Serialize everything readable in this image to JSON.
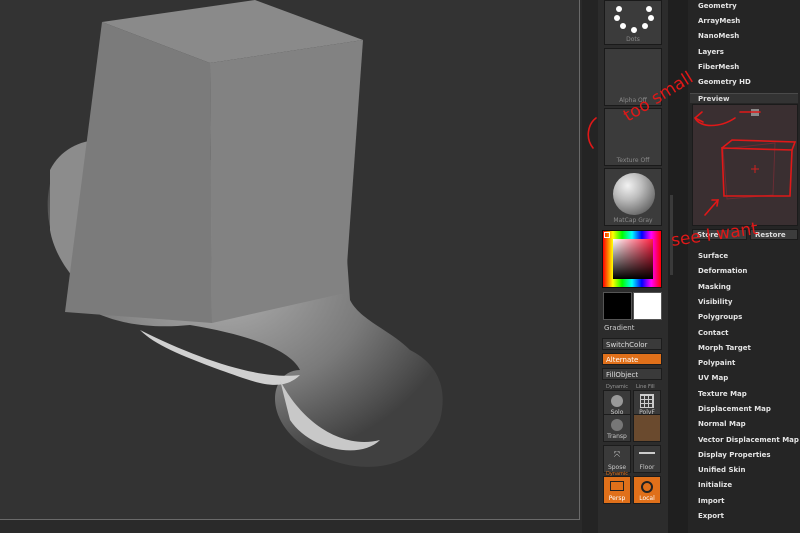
{
  "shelf": {
    "dots_label": "Dots",
    "alpha_label": "Alpha Off",
    "texture_label": "Texture Off",
    "matcap_label": "MatCap Gray",
    "gradient_label": "Gradient",
    "switchcolor_label": "SwitchColor",
    "alternate_label": "Alternate",
    "fillobject_label": "FillObject",
    "dynamic_label": "Dynamic",
    "linefill_label": "Line Fill",
    "solo_label": "Solo",
    "polyf_label": "PolyF",
    "transp_label": "Transp",
    "spose_label": "Spose",
    "floor_label": "Floor",
    "dynamic2_label": "Dynamic",
    "persp_label": "Persp",
    "local_label": "Local"
  },
  "menu": {
    "top_items": [
      "Geometry",
      "ArrayMesh",
      "NanoMesh",
      "Layers",
      "FiberMesh",
      "Geometry HD"
    ],
    "preview_label": "Preview",
    "store_label": "Store",
    "restore_label": "Restore",
    "bottom_items": [
      "Surface",
      "Deformation",
      "Masking",
      "Visibility",
      "Polygroups",
      "Contact",
      "Morph Target",
      "Polypaint",
      "UV Map",
      "Texture Map",
      "Displacement Map",
      "Normal Map",
      "Vector Displacement Map",
      "Display Properties",
      "Unified Skin",
      "Initialize",
      "Import",
      "Export"
    ]
  },
  "annotations": {
    "text_top": "too small",
    "text_bottom": "see I want"
  },
  "colors": {
    "accent_orange": "#e0701a",
    "annotation_red": "#e01818",
    "viewport_bg": "#333333"
  }
}
